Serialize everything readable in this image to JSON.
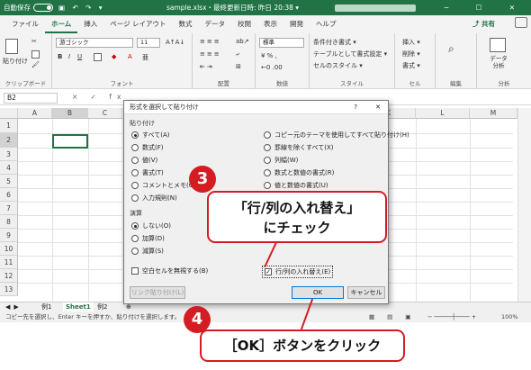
{
  "titlebar": {
    "autosave": "自動保存",
    "qa": "▣ ↶ ↷ ▾",
    "doc": "sample.xlsx・最終更新日時: 昨日 20:38 ▾",
    "win": "─ ☐ ✕"
  },
  "tabs": [
    "ファイル",
    "ホーム",
    "挿入",
    "ページ レイアウト",
    "数式",
    "データ",
    "校閲",
    "表示",
    "開発",
    "ヘルプ"
  ],
  "share": "共有",
  "ribbon": {
    "clipboard": "クリップボード",
    "paste": "貼り付け",
    "font": "フォント",
    "font_name": "游ゴシック",
    "font_size": "11",
    "align": "配置",
    "number": "数値",
    "number_fmt": "標準",
    "style": "スタイル",
    "cond": "条件付き書式 ▾",
    "table": "テーブルとして書式設定 ▾",
    "cellstyle": "セルのスタイル ▾",
    "cell": "セル",
    "ins": "挿入 ▾",
    "del": "削除 ▾",
    "fmt": "書式 ▾",
    "edit": "編集",
    "data_analysis": "データ分析",
    "analysis": "分析"
  },
  "formula": {
    "namebox": "B2",
    "fx": "× ✓ fx"
  },
  "columns": [
    "A",
    "B",
    "C",
    "D",
    "E",
    "F",
    "G",
    "H",
    "I",
    "J",
    "K",
    "L",
    "M"
  ],
  "rows": [
    "1",
    "2",
    "3",
    "4",
    "5",
    "6",
    "7",
    "8",
    "9",
    "10",
    "11",
    "12",
    "13"
  ],
  "sheets": {
    "tab1": "例1",
    "tab2": "Sheet1",
    "tab3": "例2",
    "add": "⊕"
  },
  "statusbar": {
    "msg": "コピー先を選択し、Enter キーを押すか、貼り付けを選択します。",
    "zoom": "100%"
  },
  "dialog": {
    "title": "形式を選択して貼り付け",
    "help": "?",
    "close": "✕",
    "paste_section": "貼り付け",
    "left_opts": [
      "すべて(A)",
      "数式(F)",
      "値(V)",
      "書式(T)",
      "コメントとメモ(C)",
      "入力規則(N)"
    ],
    "right_opts": [
      "コピー元のテーマを使用してすべて貼り付け(H)",
      "罫線を除くすべて(X)",
      "列幅(W)",
      "数式と数値の書式(R)",
      "値と数値の書式(U)"
    ],
    "calc_section": "演算",
    "calc_opts": [
      "しない(O)",
      "加算(D)",
      "減算(S)"
    ],
    "skip_blanks": "空白セルを無視する(B)",
    "transpose": "行/列の入れ替え(E)",
    "link_btn": "リンク貼り付け(L)",
    "ok": "OK",
    "cancel": "キャンセル"
  },
  "annotations": {
    "n3": "3",
    "c3_line1": "「行/列の入れ替え」",
    "c3_line2": "にチェック",
    "n4": "4",
    "c4": "［OK］ボタンをクリック"
  }
}
